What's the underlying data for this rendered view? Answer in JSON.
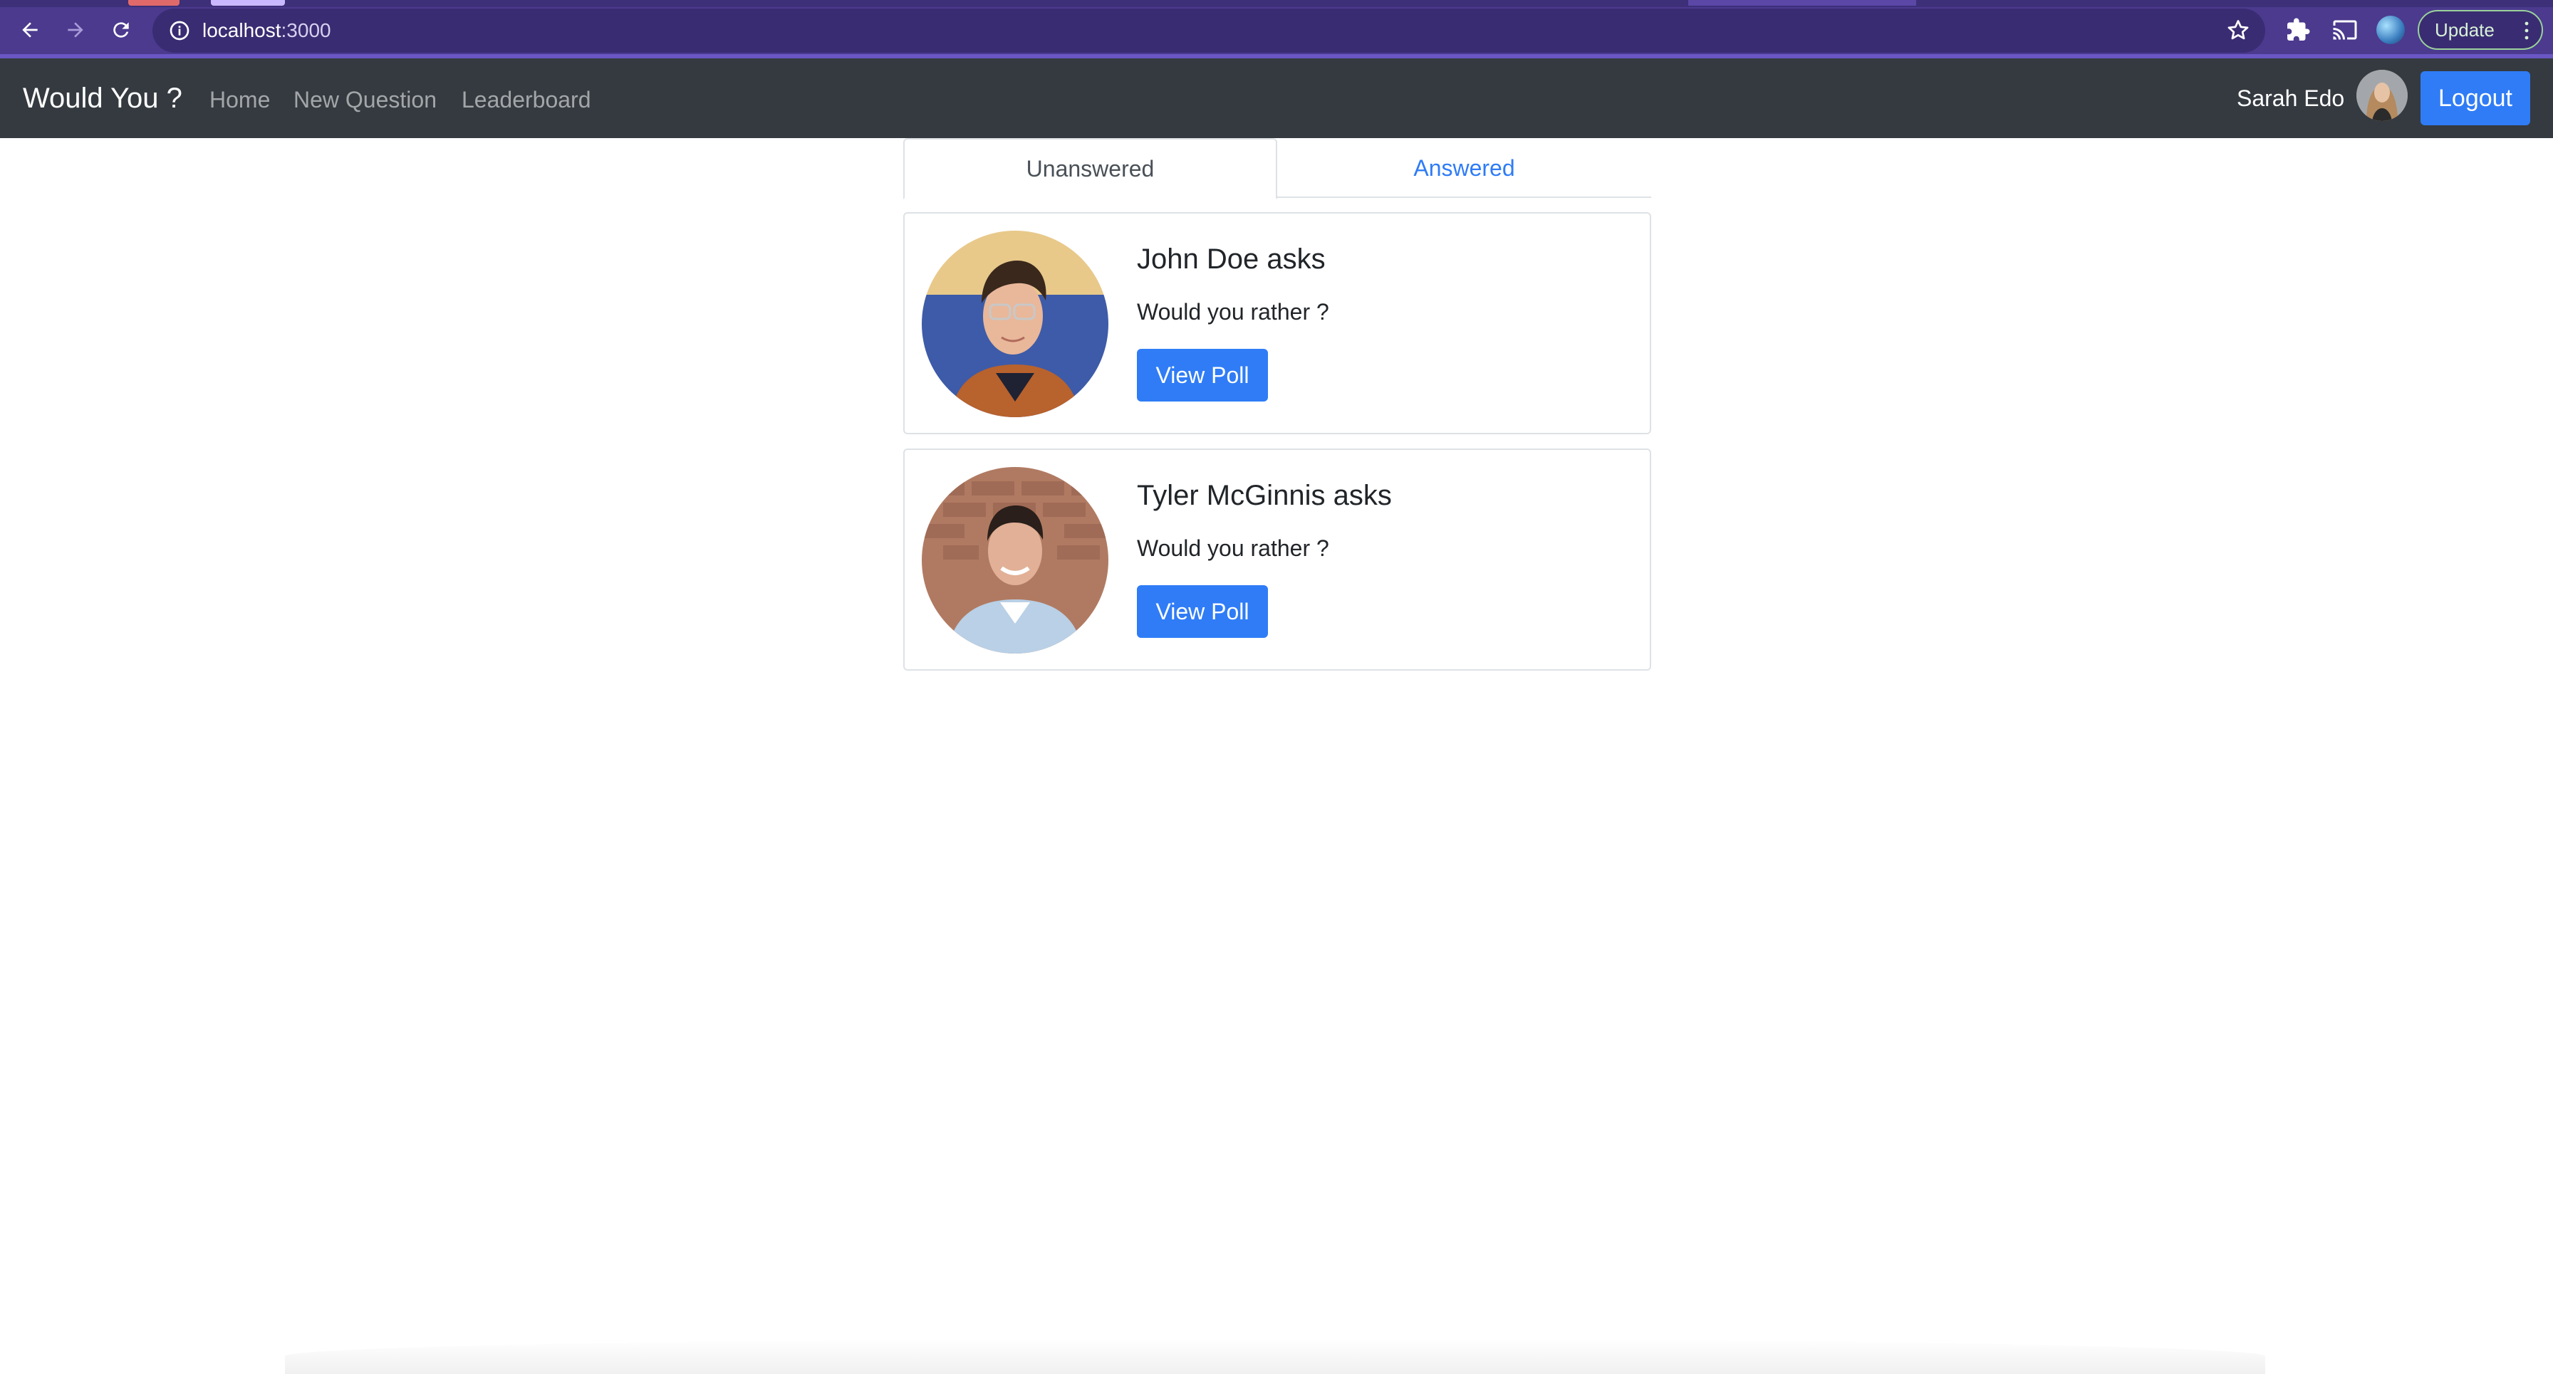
{
  "browser": {
    "url_host": "localhost",
    "url_port": ":3000",
    "update_label": "Update"
  },
  "navbar": {
    "brand": "Would You ?",
    "links": [
      {
        "label": "Home"
      },
      {
        "label": "New Question"
      },
      {
        "label": "Leaderboard"
      }
    ],
    "user_name": "Sarah Edo",
    "logout_label": "Logout"
  },
  "tabs": {
    "active": "Unanswered",
    "inactive": "Answered"
  },
  "questions": [
    {
      "author": "John Doe asks",
      "question": "Would you rather ?",
      "button": "View Poll"
    },
    {
      "author": "Tyler McGinnis asks",
      "question": "Would you rather ?",
      "button": "View Poll"
    }
  ],
  "colors": {
    "browser_frame": "#4b3a8e",
    "navbar": "#343a40",
    "primary": "#2f7cf6"
  }
}
